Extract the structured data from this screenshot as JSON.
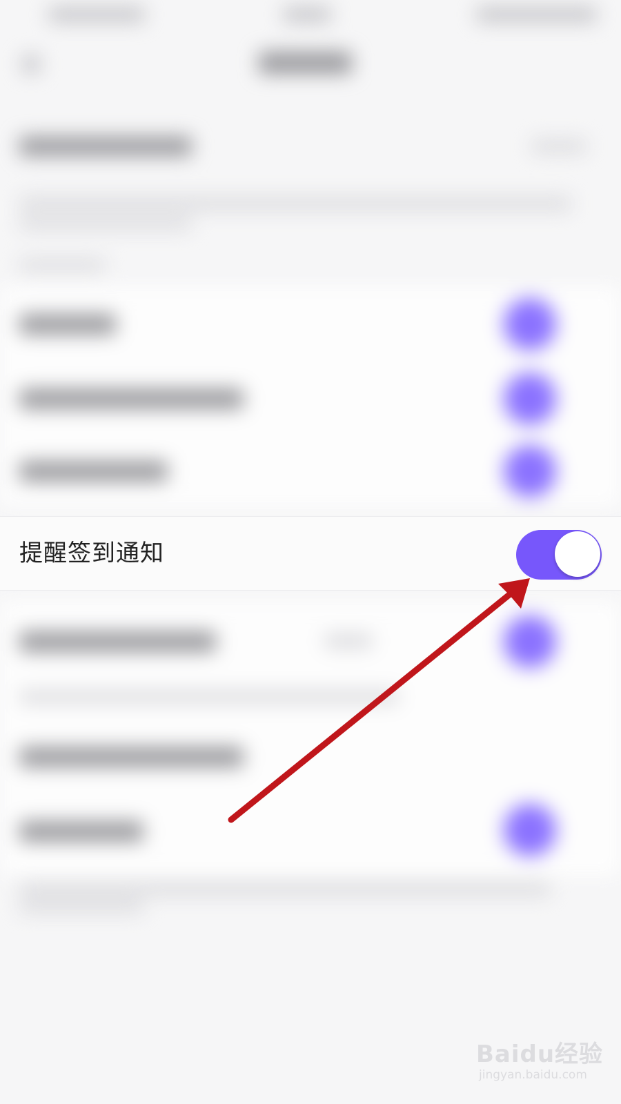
{
  "settings": {
    "highlighted_row": {
      "label": "提醒签到通知",
      "toggle_state": "on"
    }
  },
  "colors": {
    "accent": "#7757fb",
    "arrow": "#c0161b",
    "background": "#f6f6f7"
  },
  "icons": {
    "annotation": "arrow-pointer-icon"
  },
  "watermark": {
    "brand": "Baidu经验",
    "url": "jingyan.baidu.com"
  }
}
